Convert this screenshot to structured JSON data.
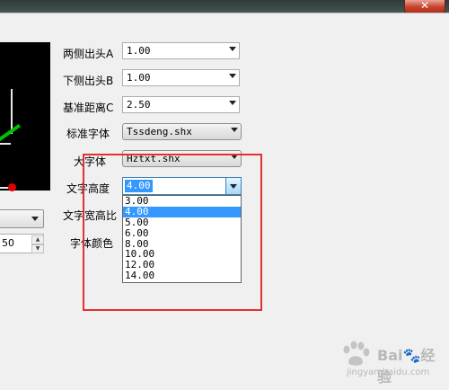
{
  "title_bar": {
    "close_glyph": "✕"
  },
  "form": {
    "fields": [
      {
        "label": "两侧出头A",
        "value": "1.00"
      },
      {
        "label": "下侧出头B",
        "value": "1.00"
      },
      {
        "label": "基准距离C",
        "value": "2.50"
      },
      {
        "label": "标准字体",
        "value": "Tssdeng.shx"
      },
      {
        "label": "大字体",
        "value": "Hztxt.shx"
      }
    ],
    "text_height": {
      "label": "文字高度",
      "value": "4.00",
      "options": [
        "3.00",
        "4.00",
        "5.00",
        "6.00",
        "8.00",
        "10.00",
        "12.00",
        "14.00"
      ],
      "selected_index": 1
    },
    "width_ratio_label": "文字宽高比",
    "font_color_label": "字体颜色"
  },
  "left_panel": {
    "spin_value": "50"
  },
  "colors": {
    "highlight": "#3399ff",
    "annotation_red": "#e53030",
    "preview_green": "#00c000"
  },
  "watermark": {
    "line1": "Bai🐾经验",
    "line2": "jingyan.baidu.com"
  }
}
